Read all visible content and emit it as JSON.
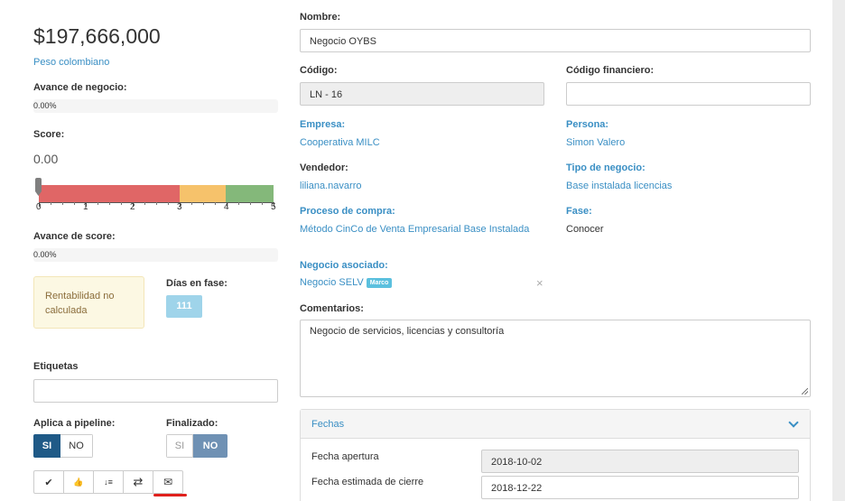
{
  "summary": {
    "amount": "$197,666,000",
    "currency": "Peso colombiano",
    "avance_negocio_label": "Avance de negocio:",
    "avance_negocio_value": "0.00%",
    "score_label": "Score:",
    "score_value": "0.00",
    "score_ticks": [
      "0",
      "1",
      "2",
      "3",
      "4",
      "5"
    ],
    "avance_score_label": "Avance de score:",
    "avance_score_value": "0.00%",
    "rentabilidad": "Rentabilidad no calculada",
    "dias_label": "Días en fase:",
    "dias_value": "111",
    "etiquetas_label": "Etiquetas",
    "etiquetas_value": "",
    "pipeline_label": "Aplica a pipeline:",
    "pipeline_si": "SI",
    "pipeline_no": "NO",
    "finalizado_label": "Finalizado:",
    "finalizado_si": "SI",
    "finalizado_no": "NO"
  },
  "colors": {
    "gauge_red": "#e06666",
    "gauge_yellow": "#f6c26b",
    "gauge_green": "#84b87a",
    "active_toggle": "#1f5a87",
    "inactive_toggle_active": "#6f91b4",
    "link_blue": "#3a8fc4",
    "badge_blue": "#5bc0de",
    "underline_red": "#e0201c"
  },
  "toolbar": {
    "icons": [
      "check-icon",
      "thumbs-up-icon",
      "sort-icon",
      "exchange-icon",
      "envelope-icon"
    ],
    "glyphs": [
      "✔",
      "👍",
      "↓≡",
      "⇄",
      "✉"
    ]
  },
  "form": {
    "nombre_label": "Nombre:",
    "nombre_value": "Negocio OYBS",
    "codigo_label": "Código:",
    "codigo_value": "LN - 16",
    "codigo_fin_label": "Código financiero:",
    "codigo_fin_value": "",
    "empresa_label": "Empresa:",
    "empresa_value": "Cooperativa MILC",
    "persona_label": "Persona:",
    "persona_value": "Simon Valero",
    "vendedor_label": "Vendedor:",
    "vendedor_value": "liliana.navarro",
    "tipo_label": "Tipo de negocio:",
    "tipo_value": "Base instalada licencias",
    "proceso_label": "Proceso de compra:",
    "proceso_value": "Método CinCo de Venta Empresarial Base Instalada",
    "fase_label": "Fase:",
    "fase_value": "Conocer",
    "asociado_label": "Negocio asociado:",
    "asociado_value": "Negocio SELV",
    "asociado_badge": "Marco",
    "asociado_remove": "×",
    "comentarios_label": "Comentarios:",
    "comentarios_value": "Negocio de servicios, licencias y consultoría"
  },
  "fechas": {
    "title": "Fechas",
    "apertura_label": "Fecha apertura",
    "apertura_value": "2018-10-02",
    "cierre_label": "Fecha estimada de cierre",
    "cierre_value": "2018-12-22"
  }
}
